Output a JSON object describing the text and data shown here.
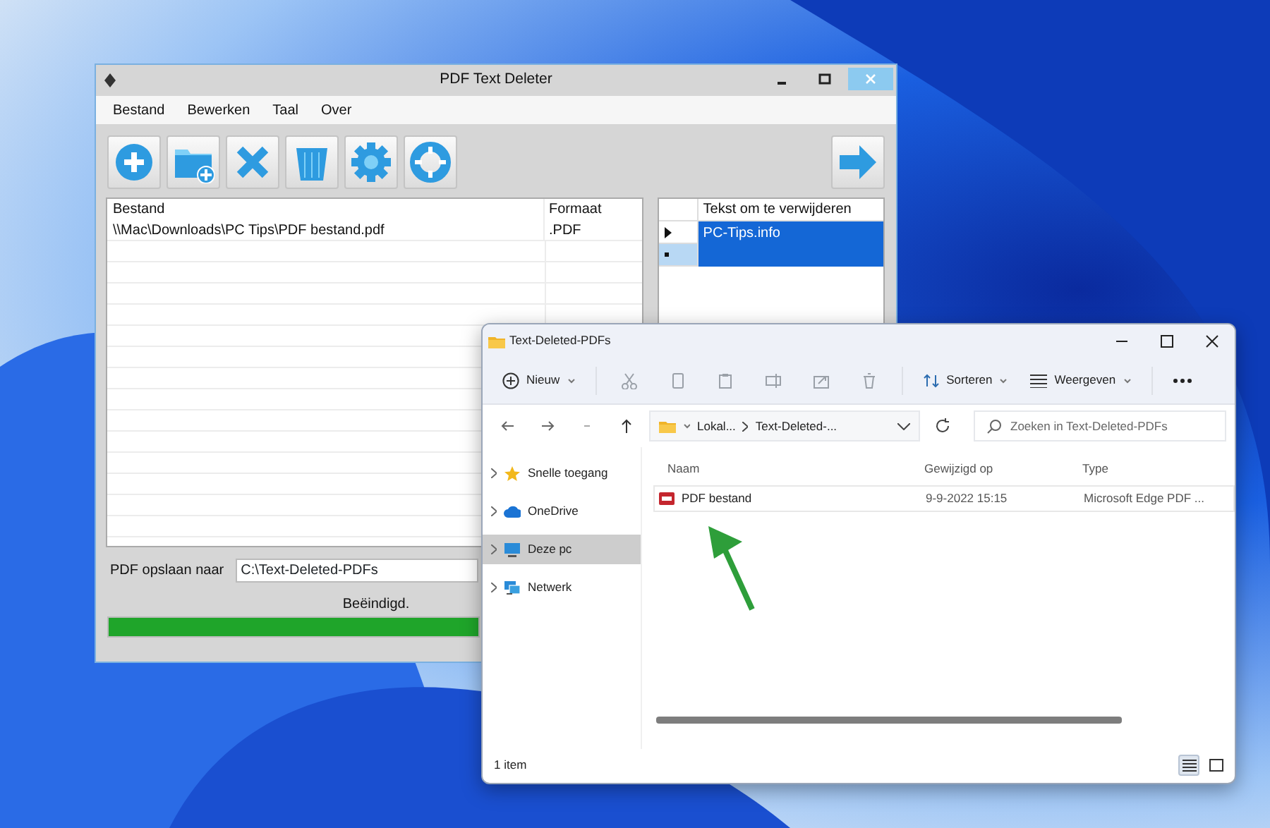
{
  "app_window": {
    "title": "PDF Text Deleter",
    "menu": [
      "Bestand",
      "Bewerken",
      "Taal",
      "Over"
    ],
    "file_table": {
      "columns": [
        "Bestand",
        "Formaat"
      ],
      "rows": [
        [
          "\\\\Mac\\Downloads\\PC Tips\\PDF bestand.pdf",
          ".PDF"
        ]
      ]
    },
    "text_table": {
      "columns": [
        "Tekst om te verwijderen"
      ],
      "rows": [
        {
          "kind": "data",
          "text": "PC-Tips.info",
          "selected": true
        },
        {
          "kind": "new",
          "selected": true
        }
      ]
    },
    "save_to": {
      "label": "PDF opslaan naar",
      "value": "C:\\Text-Deleted-PDFs"
    },
    "status": "Beëindigd.",
    "progress": {
      "level": 1
    }
  },
  "explorer_window": {
    "title": "Text-Deleted-PDFs",
    "toolbar": {
      "new": "Nieuw",
      "sort": "Sorteren",
      "view": "Weergeven"
    },
    "breadcrumb": [
      "Lokal...",
      "Text-Deleted-..."
    ],
    "search": {
      "placeholder": "Zoeken in Text-Deleted-PDFs"
    },
    "nav": [
      {
        "label": "Snelle toegang",
        "kind": "star",
        "selected": false
      },
      {
        "label": "OneDrive",
        "kind": "cloud",
        "selected": false
      },
      {
        "label": "Deze pc",
        "kind": "pc",
        "selected": true
      },
      {
        "label": "Netwerk",
        "kind": "network",
        "selected": false
      }
    ],
    "columns": [
      "Naam",
      "Gewijzigd op",
      "Type"
    ],
    "rows": [
      {
        "name": "PDF bestand",
        "modified": "9-9-2022 15:15",
        "type": "Microsoft Edge PDF ..."
      }
    ],
    "status": "1 item",
    "views": [
      {
        "kind": "details",
        "selected": true
      },
      {
        "kind": "tiles",
        "selected": false
      }
    ]
  }
}
